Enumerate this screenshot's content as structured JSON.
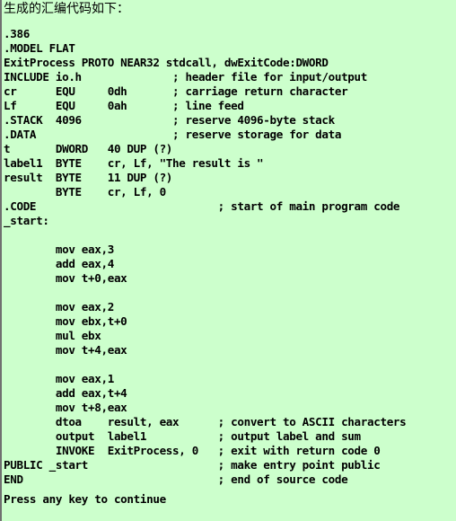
{
  "console": {
    "background_color": "#ccffcc",
    "text_color": "#000000",
    "border_color": "#707070",
    "title": "生成的汇编代码如下：",
    "footer": "Press any key to continue",
    "code_lines": [
      ".386",
      ".MODEL FLAT",
      "ExitProcess PROTO NEAR32 stdcall, dwExitCode:DWORD",
      "INCLUDE io.h              ; header file for input/output",
      "cr      EQU     0dh       ; carriage return character",
      "Lf      EQU     0ah       ; line feed",
      ".STACK  4096              ; reserve 4096-byte stack",
      ".DATA                     ; reserve storage for data",
      "t       DWORD   40 DUP (?)",
      "label1  BYTE    cr, Lf, \"The result is \"",
      "result  BYTE    11 DUP (?)",
      "        BYTE    cr, Lf, 0",
      ".CODE                            ; start of main program code",
      "_start:",
      "",
      "        mov eax,3",
      "        add eax,4",
      "        mov t+0,eax",
      "",
      "        mov eax,2",
      "        mov ebx,t+0",
      "        mul ebx",
      "        mov t+4,eax",
      "",
      "        mov eax,1",
      "        add eax,t+4",
      "        mov t+8,eax",
      "        dtoa    result, eax      ; convert to ASCII characters",
      "        output  label1           ; output label and sum",
      "        INVOKE  ExitProcess, 0   ; exit with return code 0",
      "PUBLIC _start                    ; make entry point public",
      "END                              ; end of source code"
    ]
  }
}
